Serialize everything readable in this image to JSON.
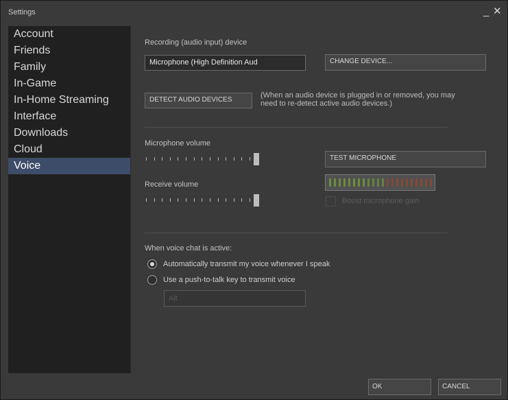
{
  "window": {
    "title": "Settings",
    "minimize": "_",
    "close": "✕"
  },
  "sidebar": {
    "items": [
      {
        "label": "Account",
        "active": false
      },
      {
        "label": "Friends",
        "active": false
      },
      {
        "label": "Family",
        "active": false
      },
      {
        "label": "In-Game",
        "active": false
      },
      {
        "label": "In-Home Streaming",
        "active": false
      },
      {
        "label": "Interface",
        "active": false
      },
      {
        "label": "Downloads",
        "active": false
      },
      {
        "label": "Cloud",
        "active": false
      },
      {
        "label": "Voice",
        "active": true
      }
    ]
  },
  "voice": {
    "recording_label": "Recording (audio input) device",
    "device_value": "Microphone (High Definition Aud",
    "change_device": "CHANGE DEVICE...",
    "detect_devices": "DETECT AUDIO DEVICES",
    "detect_note_line1": "(When an audio device is plugged in or removed, you may",
    "detect_note_line2": "need to re-detect active audio devices.)",
    "mic_volume_label": "Microphone volume",
    "mic_volume": 1.0,
    "test_microphone": "TEST MICROPHONE",
    "receive_volume_label": "Receive volume",
    "receive_volume": 1.0,
    "boost_label": "Boost microphone gain",
    "boost_checked": false,
    "when_active_label": "When voice chat is active:",
    "option_auto": "Automatically transmit my voice whenever I speak",
    "option_ptt": "Use a push-to-talk key to transmit voice",
    "selected_option": "auto",
    "ptt_key": "Alt"
  },
  "colors": {
    "meter_green": "#6d8c3c",
    "meter_red": "#8a4a35",
    "active_nav": "#3d4c68"
  },
  "footer": {
    "ok": "OK",
    "cancel": "CANCEL"
  }
}
